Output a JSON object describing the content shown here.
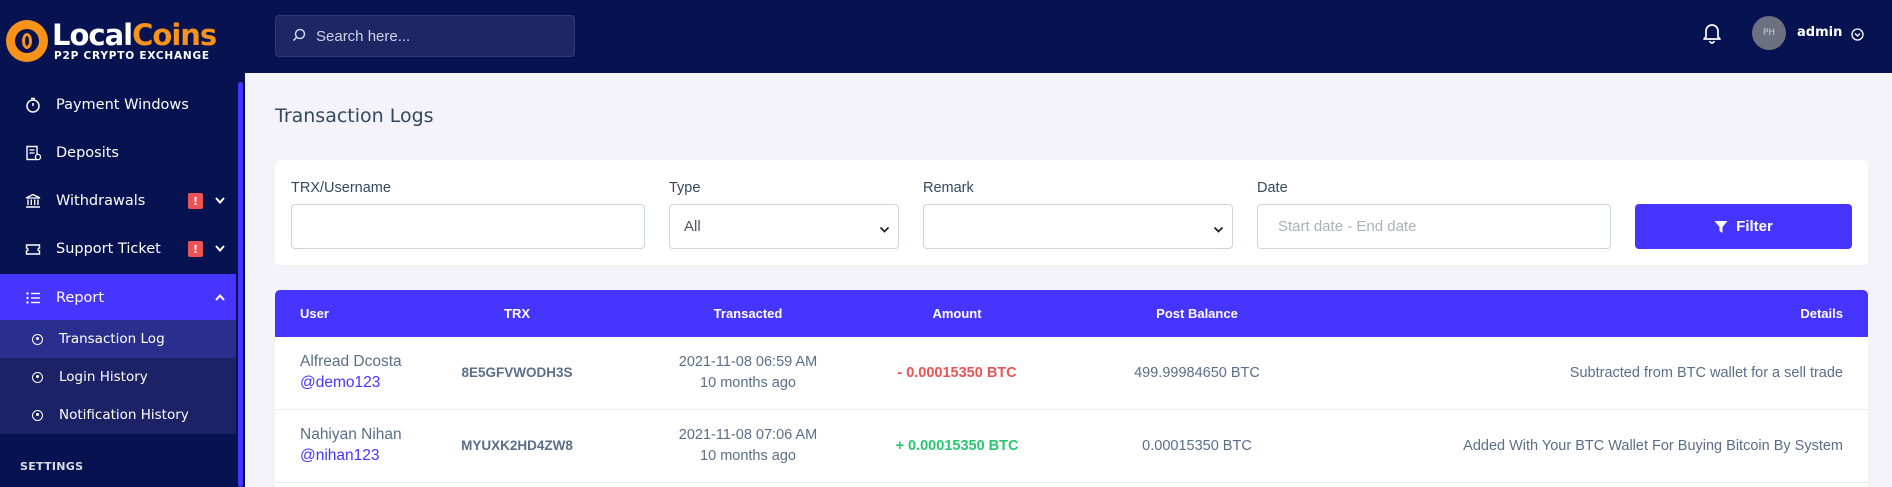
{
  "brand": {
    "name_white": "Local",
    "name_orange": "Coins",
    "tagline": "P2P CRYPTO EXCHANGE"
  },
  "sidebar": {
    "items": [
      {
        "label": "Payment Windows",
        "icon": "timer-icon"
      },
      {
        "label": "Deposits",
        "icon": "deposit-icon"
      },
      {
        "label": "Withdrawals",
        "icon": "bank-icon",
        "badge": "!"
      },
      {
        "label": "Support Ticket",
        "icon": "ticket-icon",
        "badge": "!"
      },
      {
        "label": "Report",
        "icon": "list-icon"
      }
    ],
    "report_sub": [
      {
        "label": "Transaction Log"
      },
      {
        "label": "Login History"
      },
      {
        "label": "Notification History"
      }
    ],
    "section_settings": "SETTINGS"
  },
  "topbar": {
    "search_placeholder": "Search here...",
    "avatar_text": "PH",
    "admin_name": "admin"
  },
  "page": {
    "title": "Transaction Logs"
  },
  "filters": {
    "trx_label": "TRX/Username",
    "trx_value": "",
    "type_label": "Type",
    "type_value": "All",
    "remark_label": "Remark",
    "remark_value": "",
    "date_label": "Date",
    "date_placeholder": "Start date - End date",
    "filter_button": "Filter"
  },
  "table": {
    "headers": {
      "user": "User",
      "trx": "TRX",
      "transacted": "Transacted",
      "amount": "Amount",
      "post_balance": "Post Balance",
      "details": "Details"
    },
    "rows": [
      {
        "name": "Alfread Dcosta",
        "handle": "@demo123",
        "trx": "8E5GFVWODH3S",
        "date": "2021-11-08 06:59 AM",
        "ago": "10 months ago",
        "amount": "- 0.00015350 BTC",
        "post_balance": "499.99984650 BTC",
        "details": "Subtracted from BTC wallet for a sell trade"
      },
      {
        "name": "Nahiyan Nihan",
        "handle": "@nihan123",
        "trx": "MYUXK2HD4ZW8",
        "date": "2021-11-08 07:06 AM",
        "ago": "10 months ago",
        "amount": "+ 0.00015350 BTC",
        "post_balance": "0.00015350 BTC",
        "details": "Added With Your BTC Wallet For Buying Bitcoin By System"
      }
    ]
  },
  "colors": {
    "navy": "#071251",
    "accent": "#4634ff",
    "negative": "#ea5455",
    "positive": "#28c76f",
    "orange": "#f7931a"
  }
}
